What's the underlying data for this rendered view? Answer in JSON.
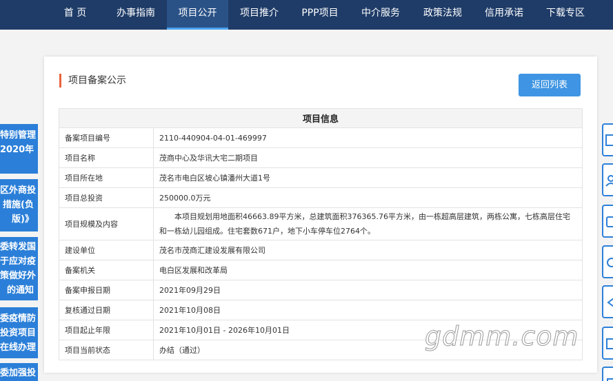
{
  "nav": {
    "items": [
      {
        "label": "首 页"
      },
      {
        "label": "办事指南"
      },
      {
        "label": "项目公开"
      },
      {
        "label": "项目推介"
      },
      {
        "label": "PPP项目"
      },
      {
        "label": "中介服务"
      },
      {
        "label": "政策法规"
      },
      {
        "label": "信用承诺"
      },
      {
        "label": "下载专区"
      }
    ]
  },
  "sidebar_left": [
    {
      "lines": [
        "特别管理",
        "2020年"
      ]
    },
    {
      "lines": [
        "区外商投",
        "措施(负",
        "版)》"
      ]
    },
    {
      "lines": [
        "委转发国",
        "于应对疫",
        "策做好外",
        "的通知"
      ]
    },
    {
      "lines": [
        "委疫情防",
        "投资项目",
        "在线办理"
      ]
    },
    {
      "lines": [
        "委加强投"
      ]
    }
  ],
  "right_tools": [
    "document-icon",
    "user-icon",
    "edit-icon",
    "refresh-icon",
    "share-icon",
    "message-icon",
    "phone-icon"
  ],
  "panel": {
    "title": "项目备案公示",
    "back_button": "返回列表"
  },
  "table": {
    "header": "项目信息",
    "rows": [
      {
        "label": "备案项目编号",
        "value": "2110-440904-04-01-469997"
      },
      {
        "label": "项目名称",
        "value": "茂商中心及华讯大宅二期项目"
      },
      {
        "label": "项目所在地",
        "value": "茂名市电白区坡心镇潘州大道1号"
      },
      {
        "label": "项目总投资",
        "value": "250000.0万元"
      },
      {
        "label": "项目规模及内容",
        "value": "本项目规划用地面积46663.89平方米，总建筑面积376365.76平方米，由一栋超高层建筑，两栋公寓，七栋高层住宅和一栋幼儿园组成。住宅套数671户，地下小车停车位2764个。"
      },
      {
        "label": "建设单位",
        "value": "茂名市茂商汇建设发展有限公司"
      },
      {
        "label": "备案机关",
        "value": "电白区发展和改革局"
      },
      {
        "label": "备案申报日期",
        "value": "2021年09月29日"
      },
      {
        "label": "复核通过日期",
        "value": "2021年10月08日"
      },
      {
        "label": "项目起止年限",
        "value": "2021年10月01日 - 2026年10月01日"
      },
      {
        "label": "项目当前状态",
        "value": "办结（通过）"
      }
    ]
  },
  "watermark": "gdmm.com",
  "colors": {
    "nav_bg": "#1f3c68",
    "accent_blue": "#2b7fd8",
    "title_bar": "#e8633d",
    "button": "#3f95e3"
  }
}
